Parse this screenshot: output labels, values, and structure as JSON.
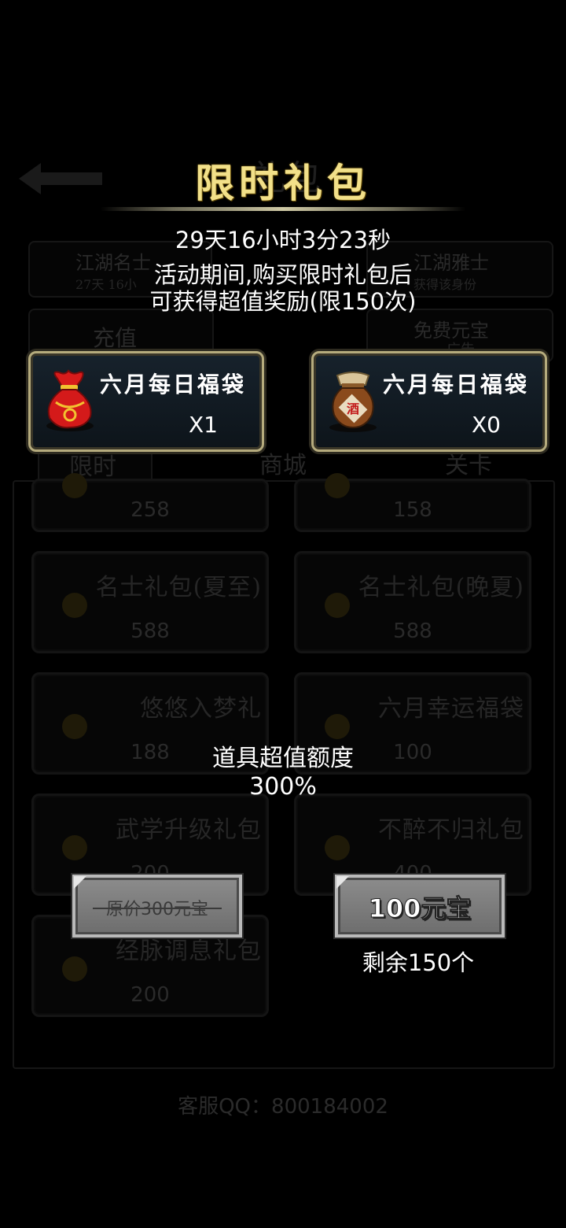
{
  "background": {
    "back_label": "返回",
    "header_title": "礼包",
    "rank_left": {
      "title": "江湖名士",
      "sub": "27天 16小"
    },
    "rank_right": {
      "title": "江湖雅士",
      "sub": "获得该身份"
    },
    "btn_recharge": "充值",
    "btn_free": {
      "title": "免费元宝",
      "sub": "广告"
    },
    "tabs": [
      "限时",
      "商城",
      "关卡"
    ],
    "cards": [
      {
        "title": "",
        "price": "258"
      },
      {
        "title": "",
        "price": "158"
      },
      {
        "title": "名士礼包(夏至)",
        "price": "588"
      },
      {
        "title": "名士礼包(晚夏)",
        "price": "588"
      },
      {
        "title": "悠悠入梦礼",
        "price": "188"
      },
      {
        "title": "六月幸运福袋",
        "price": "100"
      },
      {
        "title": "武学升级礼包",
        "price": "200"
      },
      {
        "title": "不醉不归礼包",
        "price": "400"
      },
      {
        "title": "经脉调息礼包",
        "price": "200"
      }
    ],
    "customer_service": "客服QQ：800184002"
  },
  "modal": {
    "title": "限时礼包",
    "countdown": "29天16小时3分23秒",
    "desc_line1": "活动期间,购买限时礼包后",
    "desc_line2": "可获得超值奖励(限150次)",
    "items": [
      {
        "name": "六月每日福袋",
        "qty": "X1",
        "icon": "lucky-bag-icon"
      },
      {
        "name": "六月每日福袋",
        "qty": "X0",
        "icon": "wine-jar-icon"
      }
    ],
    "value_label": "道具超值额度",
    "value_percent": "300%",
    "original_price": "原价300元宝",
    "buy_price": "100元宝",
    "remaining": "剩余150个"
  },
  "colors": {
    "title_gold": "#f2e089",
    "card_border": "#b5ab7d",
    "background": "#000000"
  }
}
